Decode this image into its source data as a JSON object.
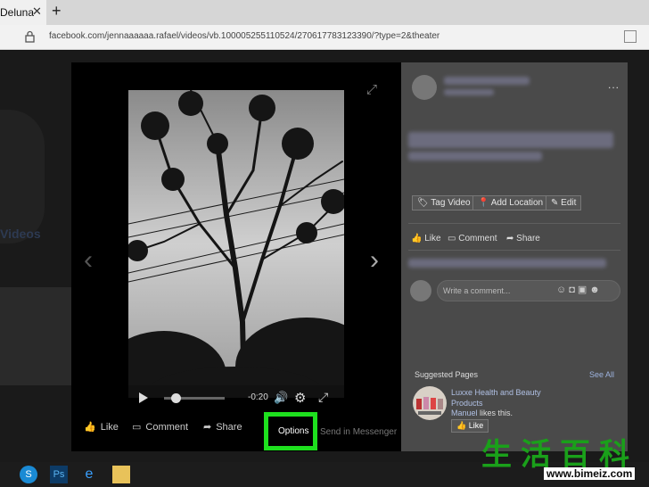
{
  "browser": {
    "tab_title": "Deluna",
    "tab_close": "✕",
    "new_tab": "+",
    "url": "facebook.com/jennaaaaaa.rafael/videos/vb.100005255110524/270617783123390/?type=2&theater"
  },
  "background": {
    "heading": "Videos"
  },
  "player": {
    "time": "-0:20",
    "progress": 0.12,
    "prev_arrow": "‹",
    "next_arrow": "›"
  },
  "video_actions": {
    "like": "Like",
    "comment": "Comment",
    "share": "Share",
    "options": "Options",
    "send_in_messenger": "Send in Messenger"
  },
  "panel": {
    "more": "...",
    "tag_video": "Tag Video",
    "add_location": "Add Location",
    "edit": "Edit",
    "like": "Like",
    "comment": "Comment",
    "share": "Share",
    "comment_placeholder": "Write a comment...",
    "suggested_title": "Suggested Pages",
    "see_all": "See All",
    "page_name_1": "Luxxe Health and Beauty",
    "page_name_2": "Products",
    "friend_name": "Manuel",
    "friend_suffix": " likes this.",
    "page_like": "Like"
  },
  "watermark": {
    "chars": "生活百科",
    "url": "www.bimeiz.com"
  },
  "colors": {
    "highlight": "#1ee01e",
    "viewer_bg": "#000000",
    "panel_bg": "#4a4a4a"
  }
}
